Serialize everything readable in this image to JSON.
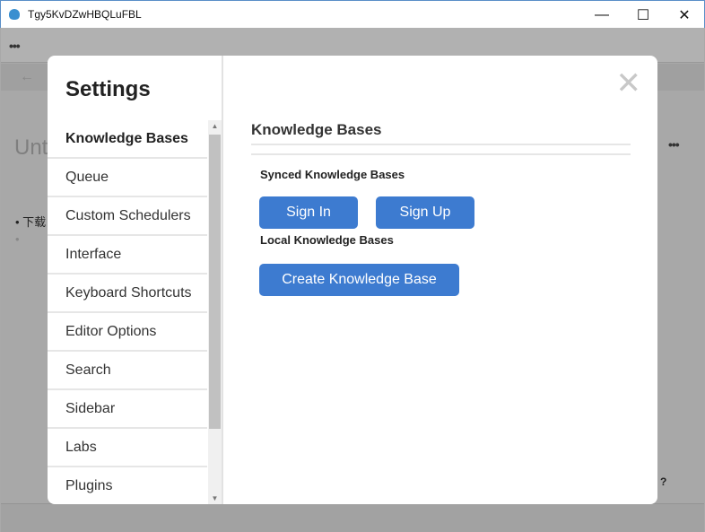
{
  "window": {
    "title": "Tgy5KvDZwHBQLuFBL",
    "minimize": "—",
    "maximize": "☐",
    "close": "✕"
  },
  "background": {
    "menu_dots": "•••",
    "back_arrow": "←",
    "doc_title_partial": "Unt",
    "bullet_text_partial": "下载",
    "more_dots": "•••",
    "help": "?"
  },
  "settings": {
    "title": "Settings",
    "close": "✕",
    "nav": [
      {
        "label": "Knowledge Bases",
        "active": true
      },
      {
        "label": "Queue"
      },
      {
        "label": "Custom Schedulers"
      },
      {
        "label": "Interface"
      },
      {
        "label": "Keyboard Shortcuts"
      },
      {
        "label": "Editor Options"
      },
      {
        "label": "Search"
      },
      {
        "label": "Sidebar"
      },
      {
        "label": "Labs"
      },
      {
        "label": "Plugins"
      }
    ],
    "panel": {
      "heading": "Knowledge Bases",
      "synced_label": "Synced Knowledge Bases",
      "sign_in": "Sign In",
      "sign_up": "Sign Up",
      "local_label": "Local Knowledge Bases",
      "create": "Create Knowledge Base"
    }
  },
  "colors": {
    "accent": "#3d7bd0"
  }
}
